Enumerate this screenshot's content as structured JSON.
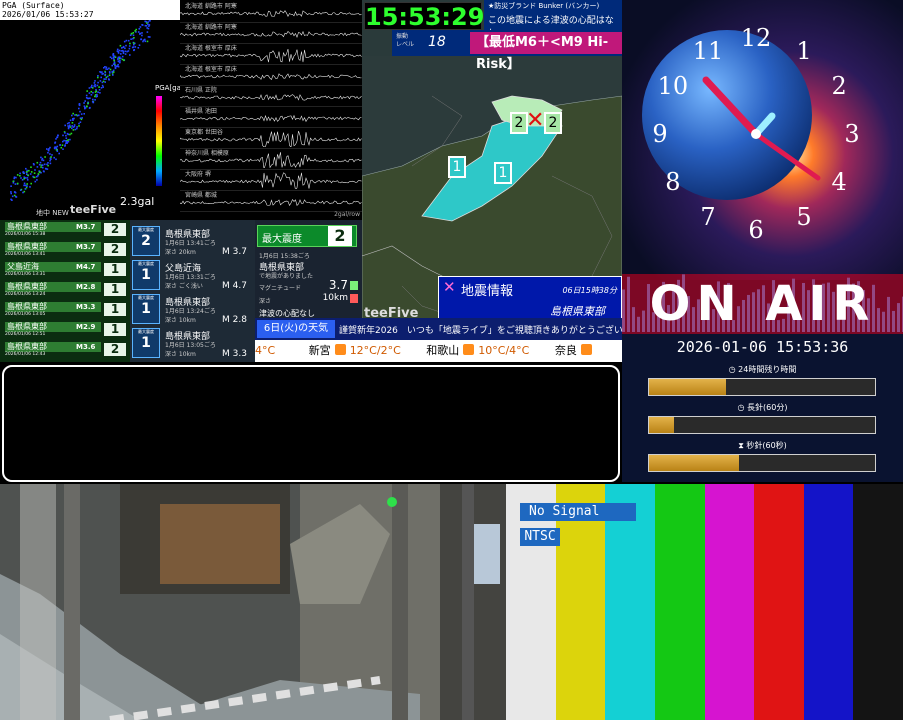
{
  "pga": {
    "header_line1": "PGA (Surface)",
    "header_line2": "2026/01/06 15:53:27",
    "scale_title": "PGA[gal]",
    "gal_small": "2.3gal",
    "gal_big": "2.3gal",
    "new_label": "地中 NEW",
    "brand": "teeFive"
  },
  "waveforms": {
    "rows": [
      {
        "label": "北海道 釧路市 阿寒"
      },
      {
        "label": "北海道 釧路市 阿寒"
      },
      {
        "label": "北海道 根室市 厚床"
      },
      {
        "label": "北海道 根室市 厚床"
      },
      {
        "label": "石川県 正院"
      },
      {
        "label": "福井県 池田"
      },
      {
        "label": "東京都 世田谷"
      },
      {
        "label": "神奈川県 相模原"
      },
      {
        "label": "大阪府 堺"
      },
      {
        "label": "宮崎県 都城"
      }
    ],
    "unit": "2gal/row"
  },
  "header": {
    "clock": "15:53:29",
    "bunker_title": "★防災ブランド Bunker (バンカー)",
    "bunker_msg": "この地震による津波の心配はなし",
    "level_label_1": "振動",
    "level_label_2": "レベル",
    "level_value": "18",
    "risk": "【最低M6＋<M9 Hi-Risk】"
  },
  "map": {
    "cross_label": "2",
    "areas": [
      "1",
      "1",
      "2"
    ],
    "quake_info_title": "地震情報",
    "quake_info_time": "06日15時38分",
    "quake_info_region": "島根県東部",
    "brand": "teeFive"
  },
  "quake_list": {
    "header": "最大震度",
    "items": [
      {
        "name": "島根県東部",
        "date": "2026/01/06 15:38",
        "mag": "M3.7",
        "int": "2"
      },
      {
        "name": "島根県東部",
        "date": "2026/01/06 13:41",
        "mag": "M3.7",
        "int": "2"
      },
      {
        "name": "父島近海",
        "date": "2026/01/06 13:31",
        "mag": "M4.7",
        "int": "1"
      },
      {
        "name": "島根県東部",
        "date": "2026/01/06 13:24",
        "mag": "M2.8",
        "int": "1"
      },
      {
        "name": "島根県東部",
        "date": "2026/01/06 13:05",
        "mag": "M3.3",
        "int": "1"
      },
      {
        "name": "島根県東部",
        "date": "2026/01/06 12:51",
        "mag": "M2.9",
        "int": "1"
      },
      {
        "name": "島根県東部",
        "date": "2026/01/06 12:43",
        "mag": "M3.6",
        "int": "2"
      }
    ]
  },
  "quake_detail": {
    "badge_title": "最大震度",
    "items": [
      {
        "int": "2",
        "region": "島根県東部",
        "date": "1月6日 13:41ごろ",
        "depth": "深さ 20km",
        "mag": "M 3.7"
      },
      {
        "int": "1",
        "region": "父島近海",
        "date": "1月6日 13:31ごろ",
        "depth": "深さ ごく浅い",
        "mag": "M 4.7"
      },
      {
        "int": "1",
        "region": "島根県東部",
        "date": "1月6日 13:24ごろ",
        "depth": "深さ 10km",
        "mag": "M 2.8"
      },
      {
        "int": "1",
        "region": "島根県東部",
        "date": "1月6日 13:05ごろ",
        "depth": "深さ 10km",
        "mag": "M 3.3"
      }
    ]
  },
  "max_intensity": {
    "title": "最大震度",
    "value": "2",
    "datetime": "1月6日 15:38ごろ",
    "region": "島根県東部",
    "region_sub": "で地震がありました",
    "mag_label": "マグニチュード",
    "mag_value": "3.7",
    "depth_label": "深さ",
    "depth_value": "10km",
    "tsunami": "津波の心配なし"
  },
  "ticker": {
    "tag": "6日(火)の天気",
    "message": "謹賀新年2026　いつも「地震ライブ」をご視聴頂きありがとうございます!",
    "weather": [
      {
        "city": "",
        "temp": "4°C"
      },
      {
        "city": "新宮",
        "temp": "12°C/2°C"
      },
      {
        "city": "和歌山",
        "temp": "10°C/4°C"
      },
      {
        "city": "奈良",
        "temp": ""
      }
    ]
  },
  "clock_panel": {
    "numerals": [
      "12",
      "1",
      "2",
      "3",
      "4",
      "5",
      "6",
      "7",
      "8",
      "9",
      "10",
      "11"
    ],
    "on_air": "ON AIR",
    "datetime": "2026-01-06 15:53:36",
    "timers": [
      {
        "label": "24時間残り時間",
        "fraction": 0.34
      },
      {
        "label": "長針(60分)",
        "fraction": 0.11
      },
      {
        "label": "秒針(60秒)",
        "fraction": 0.4
      }
    ]
  },
  "color_bars": {
    "no_signal": "No Signal",
    "ntsc": "NTSC",
    "colors": [
      "#e8e8e8",
      "#dcd40c",
      "#14d0d4",
      "#14c814",
      "#d614d0",
      "#e01414",
      "#1414c8",
      "#141414"
    ]
  }
}
